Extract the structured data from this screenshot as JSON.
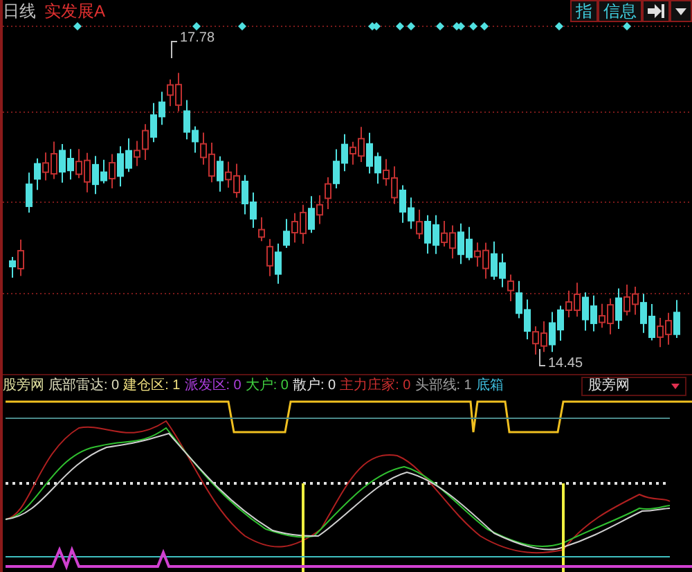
{
  "header": {
    "period": "日线",
    "stock_name": "实发展A",
    "buttons": [
      {
        "kind": "text",
        "label": "指"
      },
      {
        "kind": "text",
        "label": "信息"
      },
      {
        "kind": "icon"
      },
      {
        "kind": "dropdown"
      }
    ]
  },
  "price_chart": {
    "high_label": "17.78",
    "low_label": "14.45"
  },
  "indicator": {
    "name": "股旁网",
    "selector": "股旁网",
    "legend": [
      {
        "label": "底部雷达: 0",
        "color": "#e0e0c0"
      },
      {
        "label": "建仓区: 1",
        "color": "#f0e080"
      },
      {
        "label": "派发区: 0",
        "color": "#b040e0"
      },
      {
        "label": "大户: 0",
        "color": "#40d040"
      },
      {
        "label": "散户: 0",
        "color": "#e8e8e8"
      },
      {
        "label": "主力庄家: 0",
        "color": "#d03030"
      },
      {
        "label": "头部线: 1",
        "color": "#a0a0a0"
      },
      {
        "label": "底箱",
        "color": "#40c0e0"
      }
    ]
  }
}
